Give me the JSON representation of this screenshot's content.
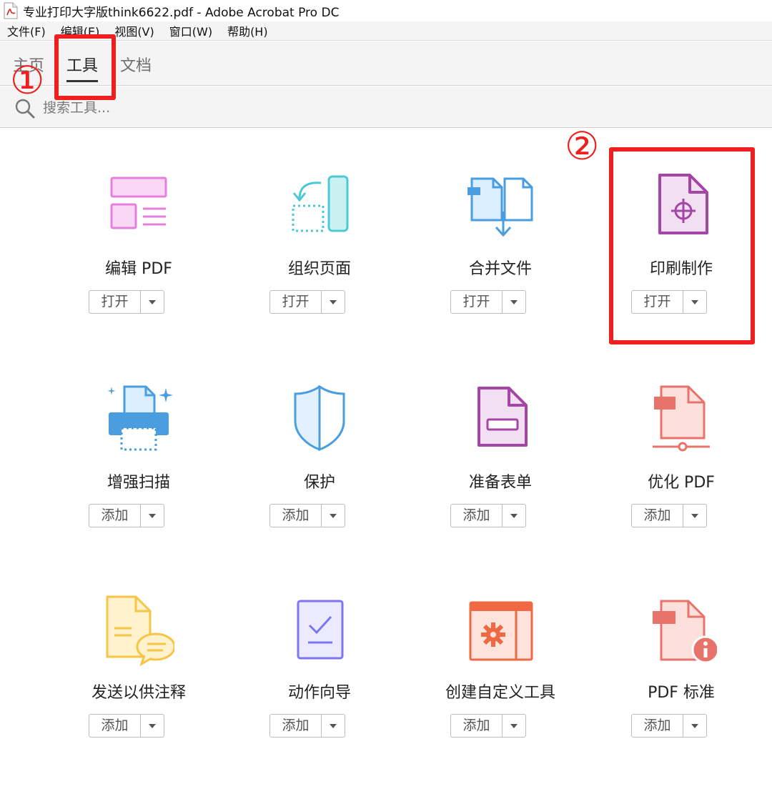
{
  "window": {
    "title": "专业打印大字版think6622.pdf - Adobe Acrobat Pro DC"
  },
  "menu": [
    "文件(F)",
    "编辑(E)",
    "视图(V)",
    "窗口(W)",
    "帮助(H)"
  ],
  "tabs": {
    "home": "主页",
    "tools": "工具",
    "document": "文档"
  },
  "search": {
    "placeholder": "搜索工具..."
  },
  "annotations": {
    "one": "①",
    "two": "②",
    "color": "#ee1f1f"
  },
  "tools": [
    {
      "label": "编辑 PDF",
      "button": "打开",
      "icon": "edit-pdf-icon"
    },
    {
      "label": "组织页面",
      "button": "打开",
      "icon": "organize-pages-icon"
    },
    {
      "label": "合并文件",
      "button": "打开",
      "icon": "combine-files-icon"
    },
    {
      "label": "印刷制作",
      "button": "打开",
      "icon": "print-production-icon"
    },
    {
      "label": "增强扫描",
      "button": "添加",
      "icon": "enhance-scans-icon"
    },
    {
      "label": "保护",
      "button": "添加",
      "icon": "protect-shield-icon"
    },
    {
      "label": "准备表单",
      "button": "添加",
      "icon": "prepare-form-icon"
    },
    {
      "label": "优化 PDF",
      "button": "添加",
      "icon": "optimize-pdf-icon"
    },
    {
      "label": "发送以供注释",
      "button": "添加",
      "icon": "send-for-comments-icon"
    },
    {
      "label": "动作向导",
      "button": "添加",
      "icon": "action-wizard-icon"
    },
    {
      "label": "创建自定义工具",
      "button": "添加",
      "icon": "create-custom-tool-icon"
    },
    {
      "label": "PDF 标准",
      "button": "添加",
      "icon": "pdf-standards-icon"
    }
  ]
}
